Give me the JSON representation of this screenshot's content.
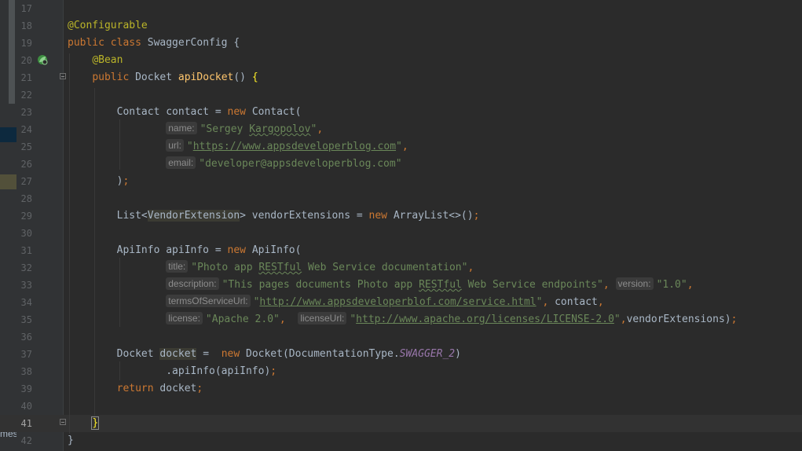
{
  "left_panel": {
    "fragment": "mes"
  },
  "editor": {
    "lines": [
      {
        "n": "17",
        "html": ""
      },
      {
        "n": "18",
        "html": "<span class=\"a\">@Configurable</span>"
      },
      {
        "n": "19",
        "html": "<span class=\"k\">public class </span>SwaggerConfig {"
      },
      {
        "n": "20",
        "html": "    <span class=\"a\">@Bean</span>"
      },
      {
        "n": "21",
        "html": "    <span class=\"k\">public </span>Docket <span class=\"m\">apiDocket</span>() <span class=\"bk\">{</span>"
      },
      {
        "n": "22",
        "html": ""
      },
      {
        "n": "23",
        "html": "        Contact contact = <span class=\"k\">new </span>Contact("
      },
      {
        "n": "24",
        "html": "                <span class=\"hint\">name:</span><span class=\"s\">\"Sergey <span class=\"wavy\">Kargopolov</span>\"</span><span class=\"k\">,</span>"
      },
      {
        "n": "25",
        "html": "                <span class=\"hint\">url:</span><span class=\"s\">\"<span class=\"u\">https://www.appsdeveloperblog.com</span>\"</span><span class=\"k\">,</span>"
      },
      {
        "n": "26",
        "html": "                <span class=\"hint\">email:</span><span class=\"s\">\"developer@appsdeveloperblog.com\"</span>"
      },
      {
        "n": "27",
        "html": "        )<span class=\"k\">;</span>"
      },
      {
        "n": "28",
        "html": ""
      },
      {
        "n": "29",
        "html": "        List&lt;<span class=\"hlw\">VendorExtension</span>&gt; vendorExtensions = <span class=\"k\">new </span>ArrayList&lt;&gt;()<span class=\"k\">;</span>"
      },
      {
        "n": "30",
        "html": ""
      },
      {
        "n": "31",
        "html": "        ApiInfo apiInfo = <span class=\"k\">new </span>ApiInfo("
      },
      {
        "n": "32",
        "html": "                <span class=\"hint\">title:</span><span class=\"s\">\"Photo app <span class=\"wavy\">RESTful</span> Web Service documentation\"</span><span class=\"k\">,</span>"
      },
      {
        "n": "33",
        "html": "                <span class=\"hint\">description:</span><span class=\"s\">\"This pages documents Photo app <span class=\"wavy\">RESTful</span> Web Service endpoints\"</span><span class=\"k\">,</span> <span class=\"hint\">version:</span><span class=\"s\">\"1.0\"</span><span class=\"k\">,</span>"
      },
      {
        "n": "34",
        "html": "                <span class=\"hint\">termsOfServiceUrl:</span><span class=\"s\">\"<span class=\"u\">http://www.appsdeveloperblof.com/service.html</span>\"</span><span class=\"k\">,</span> contact<span class=\"k\">,</span>"
      },
      {
        "n": "35",
        "html": "                <span class=\"hint\">license:</span><span class=\"s\">\"Apache 2.0\"</span><span class=\"k\">,</span>  <span class=\"hint\">licenseUrl:</span><span class=\"s\">\"<span class=\"u\">http://www.apache.org/licenses/LICENSE-2.0</span>\"</span><span class=\"k\">,</span>vendorExtensions)<span class=\"k\">;</span>"
      },
      {
        "n": "36",
        "html": ""
      },
      {
        "n": "37",
        "html": "        Docket <span class=\"hlw\">docket</span> =  <span class=\"k\">new </span>Docket(DocumentationType.<span class=\"it\">SWAGGER_2</span>)"
      },
      {
        "n": "38",
        "html": "                .apiInfo(apiInfo)<span class=\"k\">;</span>"
      },
      {
        "n": "39",
        "html": "        <span class=\"k\">return </span>docket<span class=\"k\">;</span>"
      },
      {
        "n": "40",
        "html": ""
      },
      {
        "n": "41",
        "html": "    <span class=\"bm\">}</span>",
        "current": true
      },
      {
        "n": "42",
        "html": "}"
      }
    ]
  }
}
